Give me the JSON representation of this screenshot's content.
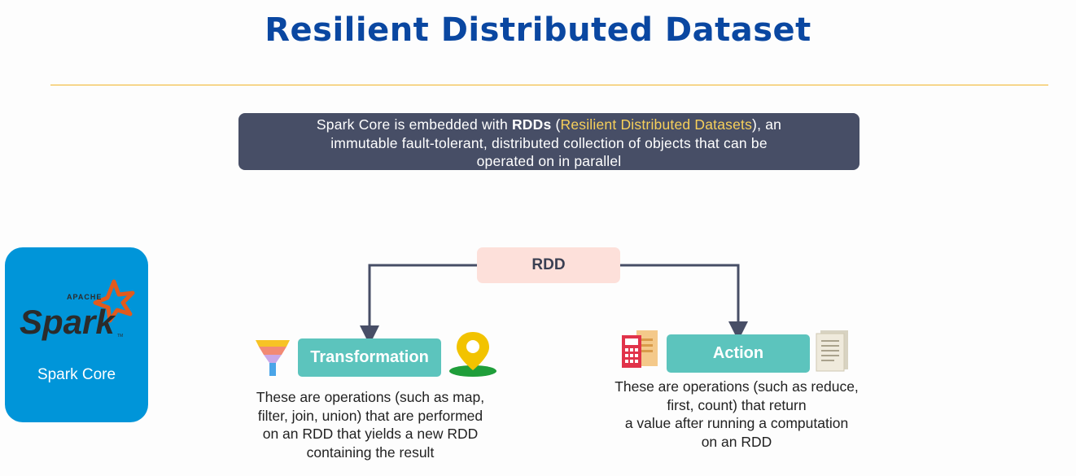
{
  "title": "Resilient Distributed Dataset",
  "description": {
    "line1_before": "Spark Core is embedded with ",
    "line1_bold": "RDDs",
    "line1_paren_open": " (",
    "line1_highlight": "Resilient Distributed Datasets",
    "line1_after": "), an",
    "line2": "immutable fault-tolerant, distributed collection of objects that can be",
    "line3": "operated on in parallel"
  },
  "spark_card": {
    "logo_top": "APACHE",
    "logo_word": "Spark",
    "logo_tm": "TM",
    "label": "Spark Core"
  },
  "diagram": {
    "root": "RDD",
    "transformation": {
      "label": "Transformation",
      "lines": [
        "These are operations (such as map,",
        "filter, join, union) that are performed",
        "on an RDD that yields a new RDD",
        "containing the result"
      ]
    },
    "action": {
      "label": "Action",
      "lines": [
        "These are operations (such as reduce,",
        "first, count) that return",
        "a value after running a computation",
        "on an RDD"
      ]
    }
  },
  "icons": {
    "transformation_left": "funnel-icon",
    "transformation_right": "map-pin-icon",
    "action_left": "calculator-document-icon",
    "action_right": "document-icon"
  },
  "colors": {
    "title": "#0a47a1",
    "divider": "#f0b429",
    "description_bg": "#474e66",
    "highlight": "#f7d05a",
    "spark_card": "#0095d9",
    "rdd_box": "#fde0da",
    "op_box": "#5cc4bd",
    "connector": "#474e66"
  }
}
